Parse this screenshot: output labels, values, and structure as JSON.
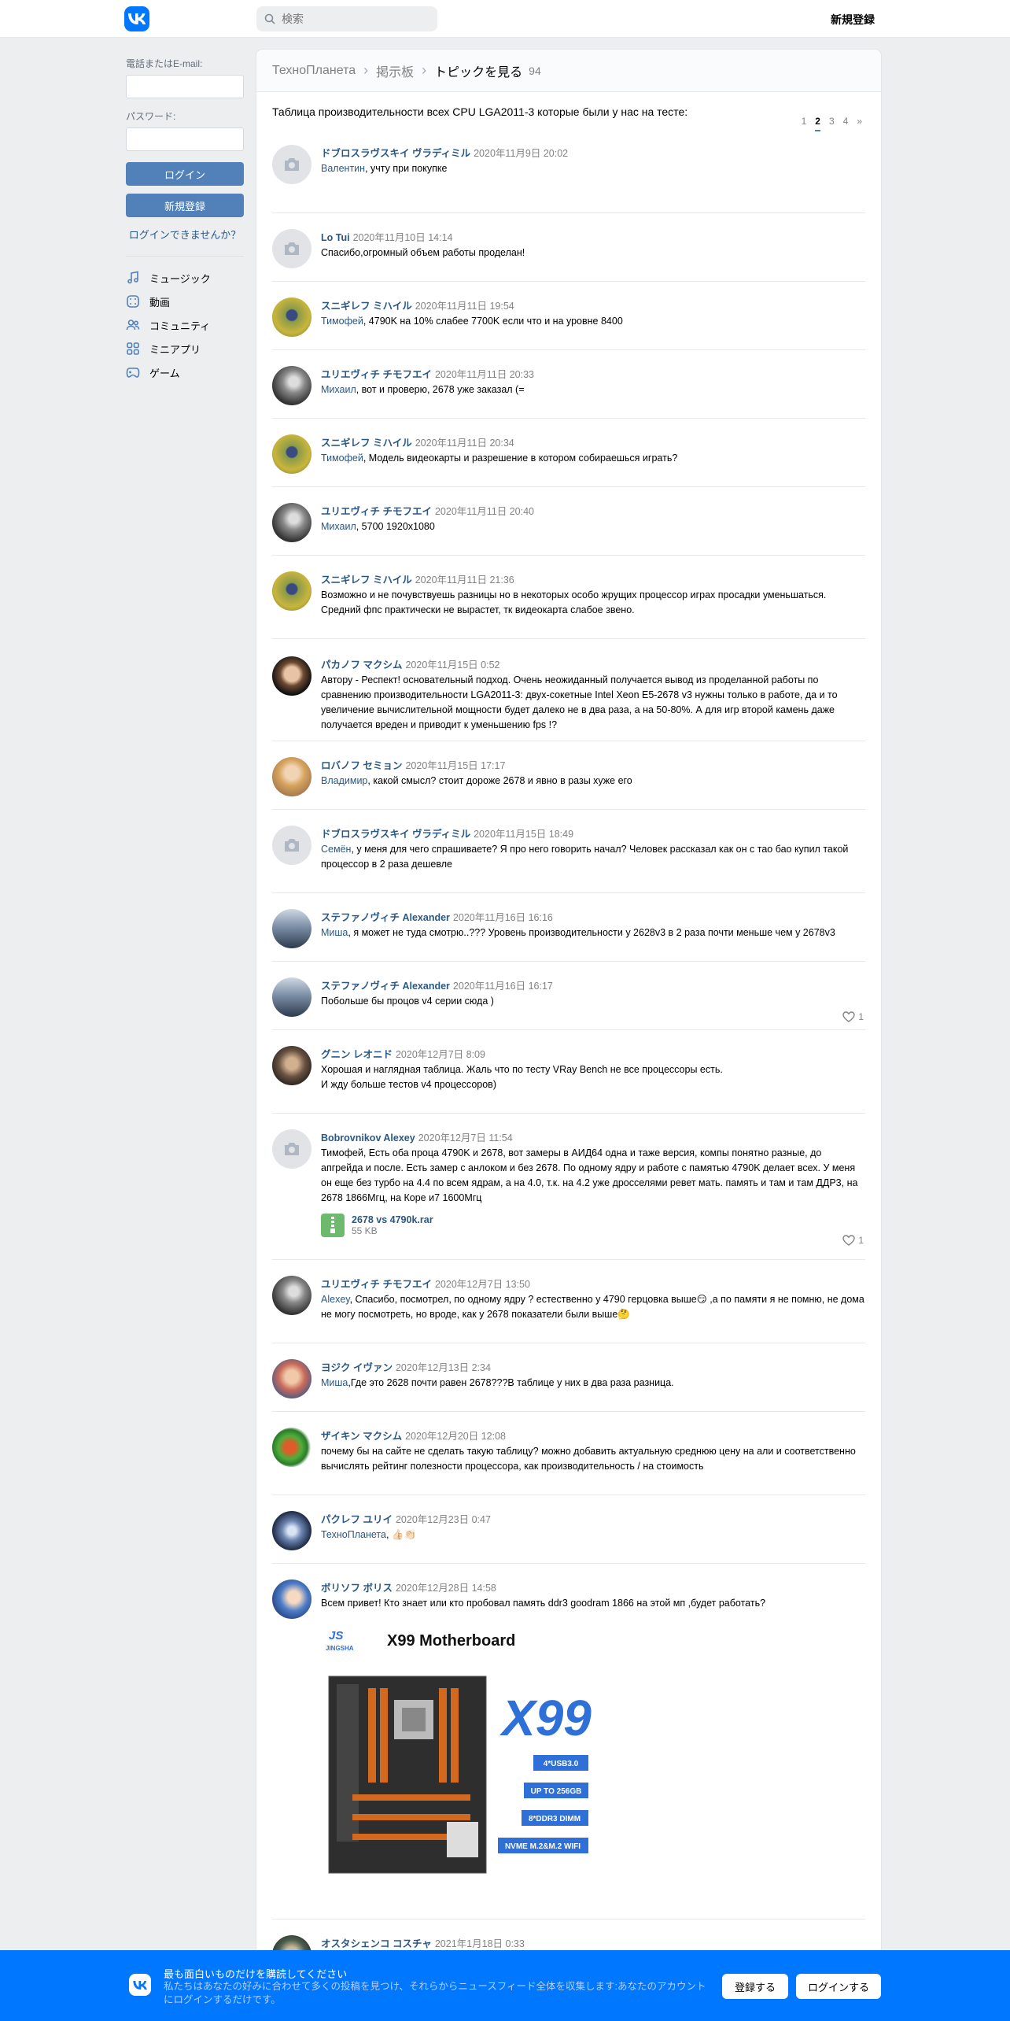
{
  "header": {
    "search_placeholder": "検索",
    "signup_label": "新規登録"
  },
  "sidebar": {
    "email_label": "電話またはE-mail:",
    "password_label": "パスワード:",
    "login_button": "ログイン",
    "signup_button": "新規登録",
    "forgot_link": "ログインできませんか？",
    "menu": [
      {
        "label": "ミュージック",
        "icon": "music-icon"
      },
      {
        "label": "動画",
        "icon": "video-icon"
      },
      {
        "label": "コミュニティ",
        "icon": "community-icon"
      },
      {
        "label": "ミニアプリ",
        "icon": "mini-apps-icon"
      },
      {
        "label": "ゲーム",
        "icon": "games-icon"
      }
    ]
  },
  "breadcrumb": {
    "group": "ТехноПланета",
    "board": "掲示板",
    "current": "トピックを見る",
    "count": "94"
  },
  "topic": {
    "title": "Таблица производительности всех CPU LGA2011-3 которые были у нас на тесте:",
    "pages": [
      "1",
      "2",
      "3",
      "4",
      "»"
    ],
    "active_page": "2"
  },
  "posts": [
    {
      "author": "ドブロスラヴスキイ ヴラディミル",
      "date": "2020年11月9日 20:02",
      "reply_to": "Валентин",
      "text": ", учту при покупке"
    },
    {
      "author": "Lo Tui",
      "date": "2020年11月10日 14:14",
      "reply_to": "",
      "text": "Спасибо,огромный объем работы проделан!"
    },
    {
      "author": "スニギレフ ミハイル",
      "date": "2020年11月11日 19:54",
      "reply_to": "Тимофей",
      "text": ", 4790K на 10% слабее 7700K если что и на уровне 8400"
    },
    {
      "author": "ユリエヴィチ チモフエイ",
      "date": "2020年11月11日 20:33",
      "reply_to": "Михаил",
      "text": ", вот и проверю, 2678 уже заказал (="
    },
    {
      "author": "スニギレフ ミハイル",
      "date": "2020年11月11日 20:34",
      "reply_to": "Тимофей",
      "text": ", Модель видеокарты и разрешение в котором собираешься играть?"
    },
    {
      "author": "ユリエヴィチ チモフエイ",
      "date": "2020年11月11日 20:40",
      "reply_to": "Михаил",
      "text": ", 5700 1920x1080"
    },
    {
      "author": "スニギレフ ミハイル",
      "date": "2020年11月11日 21:36",
      "reply_to": "",
      "text": "Возможно и не почувствуешь разницы но в некоторых особо жрущих процессор играх просадки уменьшаться. Средний фпс практически не вырастет, тк видеокарта слабое звено."
    },
    {
      "author": "パカノフ マクシム",
      "date": "2020年11月15日 0:52",
      "reply_to": "",
      "text": "Автору - Респект! основательный подход. Очень неожиданный получается вывод из проделанной работы по сравнению производительности LGA2011-3: двух-сокетные Intel Xeon E5-2678 v3 нужны только в работе, да и то увеличение вычислительной мощности будет далеко не в два раза, а на 50-80%. А для игр второй камень даже получается вреден и приводит к уменьшению fps !?"
    },
    {
      "author": "ロバノフ セミョン",
      "date": "2020年11月15日 17:17",
      "reply_to": "Владимир",
      "text": ", какой смысл? стоит дороже 2678 и явно в разы хуже его"
    },
    {
      "author": "ドブロスラヴスキイ ヴラディミル",
      "date": "2020年11月15日 18:49",
      "reply_to": "Семён",
      "text": ", у меня для чего спрашиваете? Я про него говорить начал? Человек рассказал как он с тао бао купил такой процессор в 2 раза дешевле"
    },
    {
      "author": "ステファノヴィチ Alexander",
      "date": "2020年11月16日 16:16",
      "reply_to": "Миша",
      "text": ", я может не туда смотрю..??? Уровень производительности у 2628v3 в 2 раза почти меньше чем у 2678v3"
    },
    {
      "author": "ステファノヴィチ Alexander",
      "date": "2020年11月16日 16:17",
      "reply_to": "",
      "text": "Побольше бы процов v4 серии сюда )",
      "likes": "1"
    },
    {
      "author": "グニン レオニド",
      "date": "2020年12月7日 8:09",
      "reply_to": "",
      "text": "Хорошая и наглядная таблица. Жаль что по тесту VRay Bench не все процессоры есть.",
      "text2": "И жду больше тестов v4 процессоров)"
    },
    {
      "author": "Bobrovnikov Alexey",
      "date": "2020年12月7日 11:54",
      "reply_to": "",
      "text": "Тимофей, Есть оба проца 4790K и 2678, вот замеры в АИД64 одна и таже версия, компы понятно разные, до апгрейда и после. Есть замер с анлоком и без 2678. По одному ядру и работе с памятью 4790K делает всех. У меня он еще без турбо на 4.4 по всем ядрам, а на 4.0, т.к. на 4.2 уже дросселями ревет мать. память и там и там ДДР3, на 2678 1866Мгц, на Коре и7 1600Мгц",
      "attachment": {
        "name": "2678 vs 4790k.rar",
        "size": "55 KB"
      },
      "likes": "1"
    },
    {
      "author": "ユリエヴィチ チモフエイ",
      "date": "2020年12月7日 13:50",
      "reply_to": "Alexey",
      "text": ", Спасибо, посмотрел, по одному ядру ? естественно у 4790 герцовка выше😏 ,а по памяти я не помню, не дома не могу посмотреть, но вроде, как у 2678 показатели были выше🤔"
    },
    {
      "author": "ヨジク イヴァン",
      "date": "2020年12月13日 2:34",
      "reply_to": "Миша",
      "text": ",Где это 2628 почти равен 2678???В таблице у них в два раза разница."
    },
    {
      "author": "ザイキン マクシム",
      "date": "2020年12月20日 12:08",
      "reply_to": "",
      "text": "почему бы на сайте не сделать такую таблицу? можно добавить актуальную среднюю цену на али и соответственно вычислять рейтинг полезности процессора, как производительность / на стоимость"
    },
    {
      "author": "パクレフ ユリイ",
      "date": "2020年12月23日 0:47",
      "reply_to": "ТехноПланета",
      "text": ", 👍🏻👏🏻"
    },
    {
      "author": "ボリソフ ボリス",
      "date": "2020年12月28日 14:58",
      "reply_to": "",
      "text": "Всем привет! Кто знает или кто пробовал память ddr3 goodram 1866 на этой мп ,будет работать?",
      "image": {
        "brand": "JINGSHA",
        "title": "X99 Motherboard",
        "model": "X99",
        "features": [
          "4*USB3.0",
          "UP TO 256GB",
          "8*DDR3 DIMM",
          "NVME M.2&M.2 WIFI"
        ]
      }
    },
    {
      "author": "オスタシェンコ コスチャ",
      "date": "2021年1月18日 0:33",
      "reply_to": "",
      "text": ""
    }
  ],
  "banner": {
    "title": "最も面白いものだけを購読してください",
    "text": "私たちはあなたの好みに合わせて多くの投稿を見つけ、それらからニュースフィード全体を収集します:あなたのアカウントにログインするだけです。",
    "register_button": "登録する",
    "login_button": "ログインする"
  },
  "colors": {
    "brand": "#0077ff",
    "link": "#2a5885",
    "button": "#5181b8",
    "background": "#edeef0"
  }
}
